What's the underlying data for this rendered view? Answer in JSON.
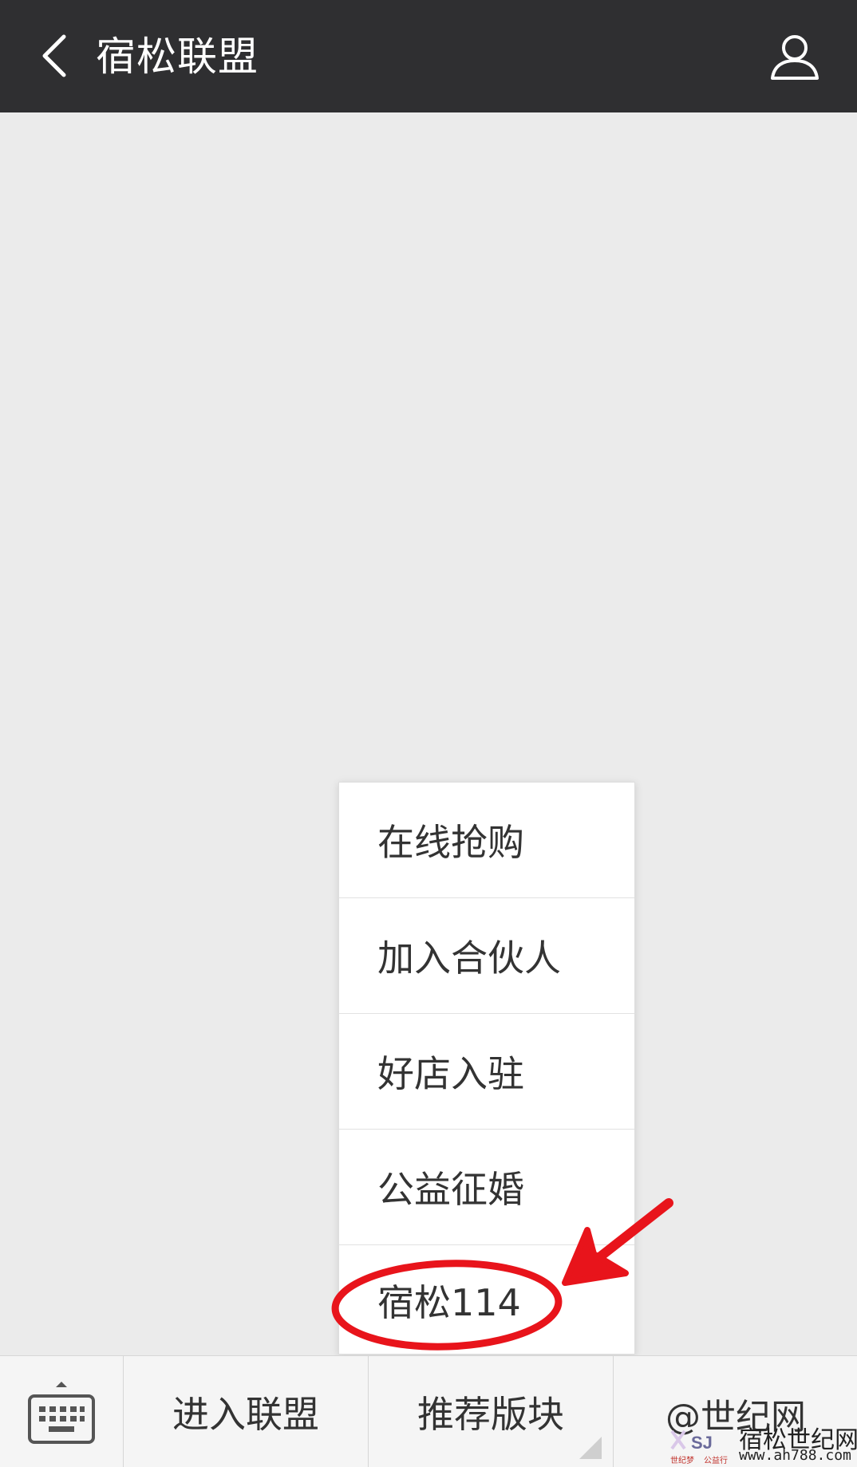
{
  "header": {
    "back_icon": "chevron-left-icon",
    "title": "宿松联盟",
    "profile_icon": "person-icon"
  },
  "popup_menu": {
    "items": [
      {
        "label": "在线抢购"
      },
      {
        "label": "加入合伙人"
      },
      {
        "label": "好店入驻"
      },
      {
        "label": "公益征婚"
      },
      {
        "label": "宿松114"
      }
    ],
    "highlighted_item": "宿松114"
  },
  "annotation": {
    "color": "#e8141b",
    "shapes": [
      "ellipse-around-item",
      "arrow-pointing-left"
    ]
  },
  "bottom_bar": {
    "keyboard_icon": "keyboard-icon",
    "tabs": [
      {
        "label": "进入联盟"
      },
      {
        "label": "推荐版块"
      },
      {
        "label": "@世纪网"
      }
    ]
  },
  "watermark": {
    "main": "@世纪网",
    "brand": "宿松世纪网",
    "url": "www.ah788.com",
    "logo_text": "SJ",
    "logo_caption_left": "世纪梦",
    "logo_caption_right": "公益行"
  },
  "colors": {
    "header_bg": "#2f2f31",
    "chat_bg": "#ebebeb",
    "menu_bg": "#ffffff",
    "text": "#333333",
    "annotation_red": "#e8141b"
  }
}
